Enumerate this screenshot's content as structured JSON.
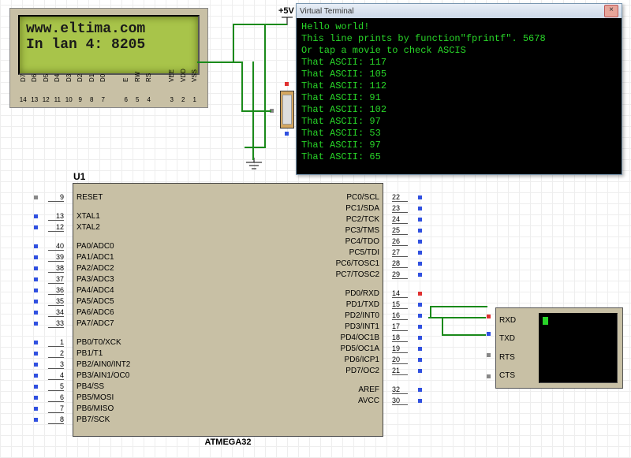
{
  "lcd": {
    "line1": "www.eltima.com",
    "line2": "In lan 4: 8205",
    "pins": [
      {
        "label": "D7",
        "num": "14"
      },
      {
        "label": "D6",
        "num": "13"
      },
      {
        "label": "D5",
        "num": "12"
      },
      {
        "label": "D4",
        "num": "11"
      },
      {
        "label": "D3",
        "num": "10"
      },
      {
        "label": "D2",
        "num": "9"
      },
      {
        "label": "D1",
        "num": "8"
      },
      {
        "label": "D0",
        "num": "7"
      },
      {
        "label": "",
        "num": ""
      },
      {
        "label": "E",
        "num": "6"
      },
      {
        "label": "RW",
        "num": "5"
      },
      {
        "label": "RS",
        "num": "4"
      },
      {
        "label": "",
        "num": ""
      },
      {
        "label": "VEE",
        "num": "3"
      },
      {
        "label": "VDD",
        "num": "2"
      },
      {
        "label": "VSS",
        "num": "1"
      }
    ]
  },
  "power": {
    "label": "+5V"
  },
  "chip": {
    "ref": "U1",
    "name": "ATMEGA32",
    "left_groups": [
      [
        {
          "num": "9",
          "label": "RESET",
          "sq": "gray"
        }
      ],
      [
        {
          "num": "13",
          "label": "XTAL1",
          "sq": "blue"
        },
        {
          "num": "12",
          "label": "XTAL2",
          "sq": "blue"
        }
      ],
      [
        {
          "num": "40",
          "label": "PA0/ADC0",
          "sq": "blue"
        },
        {
          "num": "39",
          "label": "PA1/ADC1",
          "sq": "blue"
        },
        {
          "num": "38",
          "label": "PA2/ADC2",
          "sq": "blue"
        },
        {
          "num": "37",
          "label": "PA3/ADC3",
          "sq": "blue"
        },
        {
          "num": "36",
          "label": "PA4/ADC4",
          "sq": "blue"
        },
        {
          "num": "35",
          "label": "PA5/ADC5",
          "sq": "blue"
        },
        {
          "num": "34",
          "label": "PA6/ADC6",
          "sq": "blue"
        },
        {
          "num": "33",
          "label": "PA7/ADC7",
          "sq": "blue"
        }
      ],
      [
        {
          "num": "1",
          "label": "PB0/T0/XCK",
          "sq": "blue"
        },
        {
          "num": "2",
          "label": "PB1/T1",
          "sq": "blue"
        },
        {
          "num": "3",
          "label": "PB2/AIN0/INT2",
          "sq": "blue"
        },
        {
          "num": "4",
          "label": "PB3/AIN1/OC0",
          "sq": "blue"
        },
        {
          "num": "5",
          "label": "PB4/SS",
          "sq": "blue"
        },
        {
          "num": "6",
          "label": "PB5/MOSI",
          "sq": "blue"
        },
        {
          "num": "7",
          "label": "PB6/MISO",
          "sq": "blue"
        },
        {
          "num": "8",
          "label": "PB7/SCK",
          "sq": "blue"
        }
      ]
    ],
    "right_groups": [
      [
        {
          "num": "22",
          "label": "PC0/SCL",
          "sq": "blue"
        },
        {
          "num": "23",
          "label": "PC1/SDA",
          "sq": "blue"
        },
        {
          "num": "24",
          "label": "PC2/TCK",
          "sq": "blue"
        },
        {
          "num": "25",
          "label": "PC3/TMS",
          "sq": "blue"
        },
        {
          "num": "26",
          "label": "PC4/TDO",
          "sq": "blue"
        },
        {
          "num": "27",
          "label": "PC5/TDI",
          "sq": "blue"
        },
        {
          "num": "28",
          "label": "PC6/TOSC1",
          "sq": "blue"
        },
        {
          "num": "29",
          "label": "PC7/TOSC2",
          "sq": "blue"
        }
      ],
      [
        {
          "num": "14",
          "label": "PD0/RXD",
          "sq": "red"
        },
        {
          "num": "15",
          "label": "PD1/TXD",
          "sq": "blue"
        },
        {
          "num": "16",
          "label": "PD2/INT0",
          "sq": "blue"
        },
        {
          "num": "17",
          "label": "PD3/INT1",
          "sq": "blue"
        },
        {
          "num": "18",
          "label": "PD4/OC1B",
          "sq": "blue"
        },
        {
          "num": "19",
          "label": "PD5/OC1A",
          "sq": "blue"
        },
        {
          "num": "20",
          "label": "PD6/ICP1",
          "sq": "blue"
        },
        {
          "num": "21",
          "label": "PD7/OC2",
          "sq": "blue"
        }
      ],
      [
        {
          "num": "32",
          "label": "AREF",
          "sq": "blue"
        },
        {
          "num": "30",
          "label": "AVCC",
          "sq": "blue"
        }
      ]
    ]
  },
  "vterm": {
    "title": "Virtual Terminal",
    "close": "×",
    "lines": [
      "Hello world!",
      "This line prints by function\"fprintf\". 5678",
      "Or tap a movie to check ASCIS",
      "That ASCII: 117",
      "That ASCII: 105",
      "That ASCII: 112",
      "That ASCII: 91",
      "That ASCII: 102",
      "That ASCII: 97",
      "That ASCII: 53",
      "That ASCII: 97",
      "That ASCII: 65"
    ]
  },
  "serial": {
    "pins": [
      {
        "label": "RXD",
        "sq": "red"
      },
      {
        "label": "TXD",
        "sq": "blue"
      },
      {
        "label": "RTS",
        "sq": "gray"
      },
      {
        "label": "CTS",
        "sq": "gray"
      }
    ]
  }
}
